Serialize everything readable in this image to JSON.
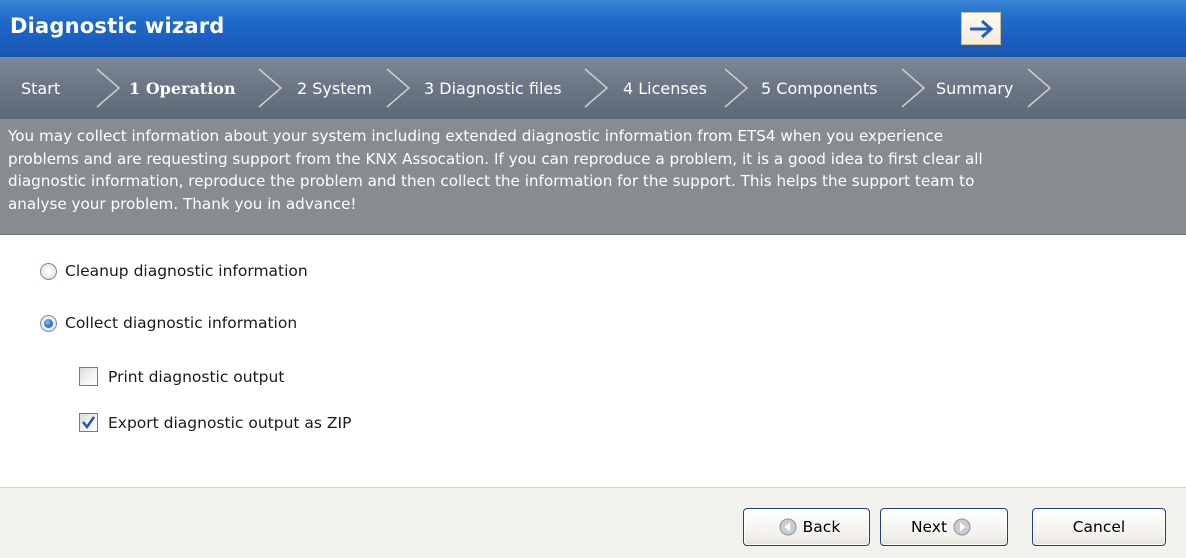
{
  "window": {
    "title": "Diagnostic wizard",
    "forward_icon": "arrow-right-icon"
  },
  "steps": [
    {
      "label": "Start",
      "active": false
    },
    {
      "label": "1 Operation",
      "active": true
    },
    {
      "label": "2 System",
      "active": false
    },
    {
      "label": "3 Diagnostic files",
      "active": false
    },
    {
      "label": "4 Licenses",
      "active": false
    },
    {
      "label": "5 Components",
      "active": false
    },
    {
      "label": "Summary",
      "active": false
    }
  ],
  "description": {
    "lines": [
      "You may collect information about your system including extended diagnostic information from ETS4 when you experience",
      "problems and are requesting support from the KNX Assocation. If you can reproduce a problem, it is a good idea to first clear all",
      "diagnostic information, reproduce the problem and then collect the information for the support. This helps the support team to",
      "analyse your problem. Thank you in advance!"
    ]
  },
  "options": {
    "cleanup": {
      "label": "Cleanup diagnostic information",
      "selected": false
    },
    "collect": {
      "label": "Collect diagnostic information",
      "selected": true
    },
    "print": {
      "label": "Print diagnostic output",
      "checked": false
    },
    "export_zip": {
      "label": "Export diagnostic output as ZIP",
      "checked": true
    }
  },
  "footer": {
    "back_label": "Back",
    "next_label": "Next",
    "cancel_label": "Cancel"
  },
  "colors": {
    "title_bar": "#1f6bc9",
    "step_bar": "#6e7987",
    "description_bg": "#888c90",
    "footer_bg": "#f2f1ec",
    "button_border": "#1f3f8a"
  }
}
